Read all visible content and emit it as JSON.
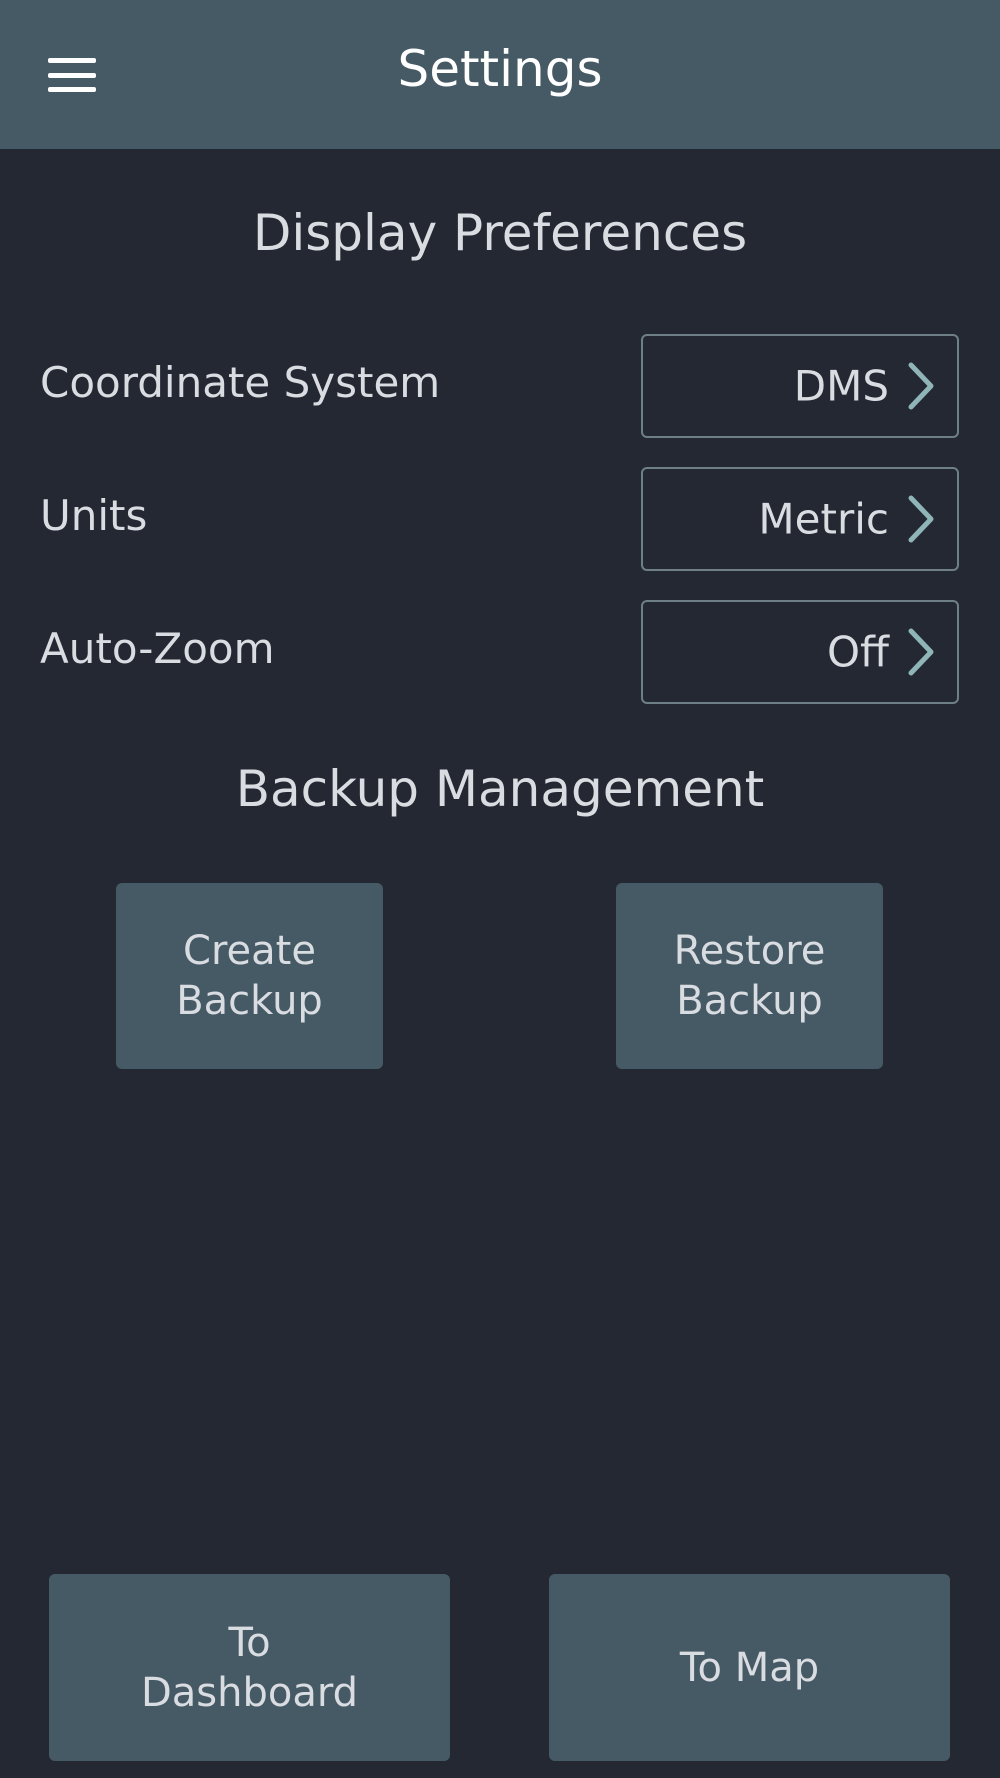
{
  "app_bar": {
    "title": "Settings",
    "menu_icon": "hamburger-menu-icon"
  },
  "display_preferences": {
    "title": "Display Preferences",
    "items": [
      {
        "label": "Coordinate System",
        "value": "DMS",
        "icon": "chevron-right-icon"
      },
      {
        "label": "Units",
        "value": "Metric",
        "icon": "chevron-right-icon"
      },
      {
        "label": "Auto-Zoom",
        "value": "Off",
        "icon": "chevron-right-icon"
      }
    ]
  },
  "backup_management": {
    "title": "Backup Management",
    "create_label": "Create\nBackup",
    "restore_label": "Restore\nBackup"
  },
  "footer": {
    "dashboard_label": "To\nDashboard",
    "map_label": "To Map"
  },
  "colors": {
    "background": "#242833",
    "app_bar": "#465a66",
    "button": "#465a66",
    "text": "#d9dce1",
    "chevron": "#8fb5b8",
    "select_border": "#6f7f87"
  }
}
